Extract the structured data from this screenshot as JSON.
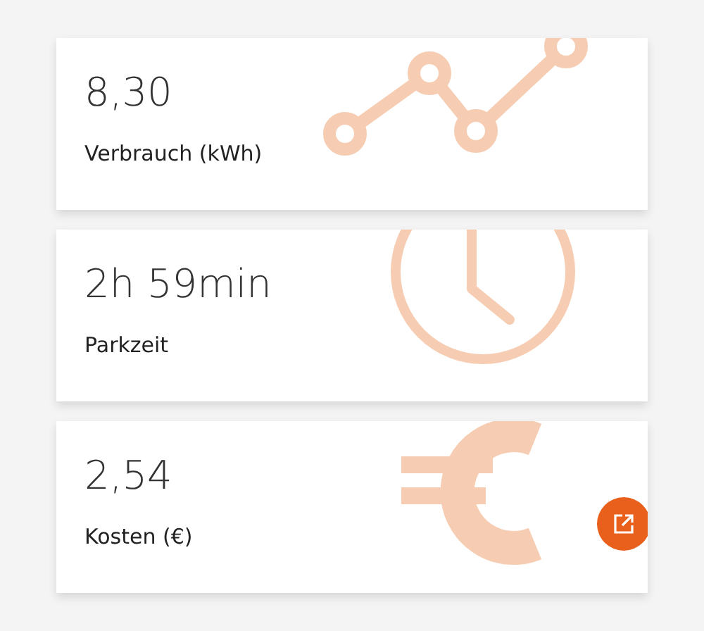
{
  "cards": [
    {
      "value": "8,30",
      "label": "Verbrauch (kWh)",
      "kind": "chart",
      "link_button": false
    },
    {
      "value": "2h 59min",
      "label": "Parkzeit",
      "kind": "clock",
      "link_button": false
    },
    {
      "value": "2,54",
      "label": "Kosten (€)",
      "kind": "euro",
      "link_button": true
    }
  ]
}
